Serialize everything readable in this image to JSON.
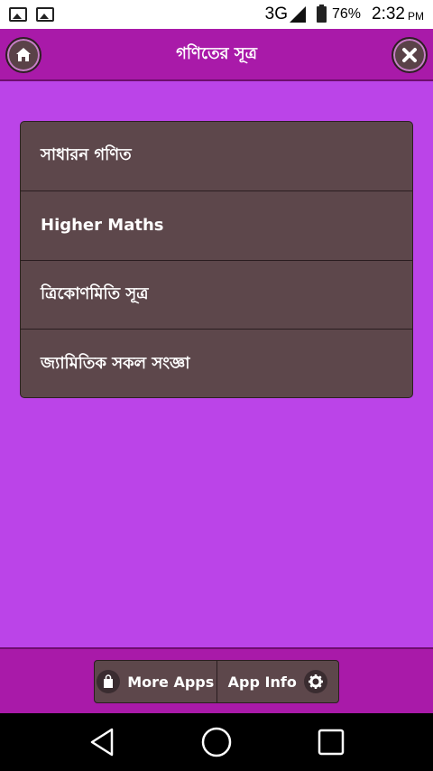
{
  "status_bar": {
    "network": "3G",
    "battery": "76%",
    "time": "2:32",
    "ampm": "PM",
    "icons": [
      "image-icon",
      "image-icon",
      "signal-icon",
      "battery-charging-icon"
    ]
  },
  "header": {
    "title": "গণিতের সূত্র",
    "home_icon": "home-icon",
    "close_icon": "close-icon"
  },
  "menu": {
    "items": [
      {
        "label": "সাধারন গণিত"
      },
      {
        "label": "Higher Maths"
      },
      {
        "label": "ত্রিকোণমিতি সূত্র"
      },
      {
        "label": "জ্যামিতিক সকল সংজ্ঞা"
      }
    ]
  },
  "footer": {
    "more_apps_label": "More Apps",
    "app_info_label": "App Info",
    "more_apps_icon": "shopping-bag-icon",
    "app_info_icon": "gear-icon"
  },
  "nav": {
    "back_icon": "back-icon",
    "home_icon": "home-circle-icon",
    "recents_icon": "recents-icon"
  },
  "colors": {
    "header_bg": "#a91aa9",
    "main_bg": "#bb44e8",
    "card_bg": "#5d474b"
  }
}
